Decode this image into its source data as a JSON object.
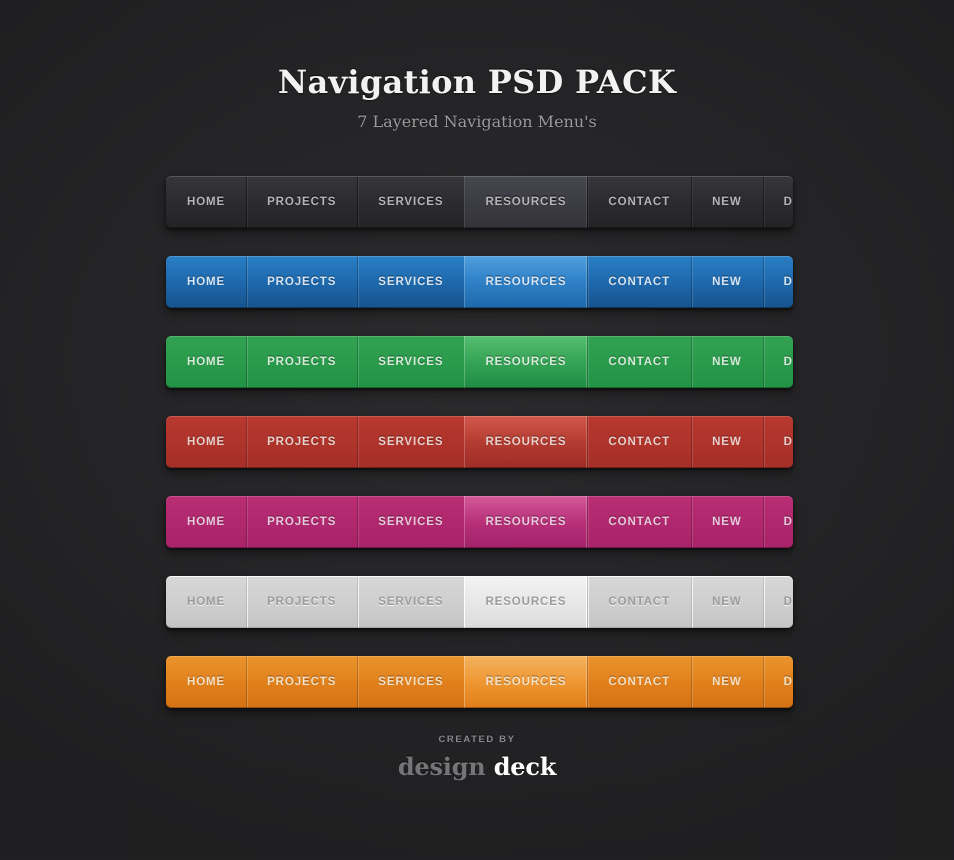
{
  "header": {
    "title": "Navigation PSD PACK",
    "subtitle": "7 Layered Navigation Menu's"
  },
  "menu_items": [
    "HOME",
    "PROJECTS",
    "SERVICES",
    "RESOURCES",
    "CONTACT",
    "NEW",
    "DEVELOPMENT"
  ],
  "active_item": "RESOURCES",
  "navbars": [
    {
      "theme": "dark",
      "base_color": "#2c2c30",
      "active_color": "#3b3b42",
      "text_color": "#b6b6b8",
      "active_text_color": "#ffffff",
      "items": [
        "HOME",
        "PROJECTS",
        "SERVICES",
        "RESOURCES",
        "CONTACT",
        "NEW",
        "DEVELOPMENT"
      ]
    },
    {
      "theme": "blue",
      "base_color": "#1f6bb0",
      "active_color": "#3183c9",
      "text_color": "#d6e5f4",
      "active_text_color": "#ffffff",
      "items": [
        "HOME",
        "PROJECTS",
        "SERVICES",
        "RESOURCES",
        "CONTACT",
        "NEW",
        "DEVELOPMENT"
      ]
    },
    {
      "theme": "green",
      "base_color": "#229345",
      "active_color": "#35a456",
      "text_color": "#d6ecd9",
      "active_text_color": "#ffffff",
      "items": [
        "HOME",
        "PROJECTS",
        "SERVICES",
        "RESOURCES",
        "CONTACT",
        "NEW",
        "DEVELOPMENT"
      ]
    },
    {
      "theme": "red",
      "base_color": "#a52f28",
      "active_color": "#b43c32",
      "text_color": "#eccfca",
      "active_text_color": "#ffffff",
      "items": [
        "HOME",
        "PROJECTS",
        "SERVICES",
        "RESOURCES",
        "CONTACT",
        "NEW",
        "DEVELOPMENT"
      ]
    },
    {
      "theme": "magenta",
      "base_color": "#a82369",
      "active_color": "#b83179",
      "text_color": "#ebc9dd",
      "active_text_color": "#ffffff",
      "items": [
        "HOME",
        "PROJECTS",
        "SERVICES",
        "RESOURCES",
        "CONTACT",
        "NEW",
        "DEVELOPMENT"
      ]
    },
    {
      "theme": "light",
      "base_color": "#cfcfcf",
      "active_color": "#e8e8e8",
      "text_color": "#9c9c9c",
      "active_text_color": "#454545",
      "items": [
        "HOME",
        "PROJECTS",
        "SERVICES",
        "RESOURCES",
        "CONTACT",
        "NEW",
        "DEVELOPMENT"
      ]
    },
    {
      "theme": "orange",
      "base_color": "#e07f1c",
      "active_color": "#ee9833",
      "text_color": "#f6e0c2",
      "active_text_color": "#ffffff",
      "items": [
        "HOME",
        "PROJECTS",
        "SERVICES",
        "RESOURCES",
        "CONTACT",
        "NEW",
        "DEVELOPMENT"
      ]
    }
  ],
  "footer": {
    "created_by": "CREATED BY",
    "brand_first": "design",
    "brand_second": "deck"
  },
  "background_color": "#232325"
}
